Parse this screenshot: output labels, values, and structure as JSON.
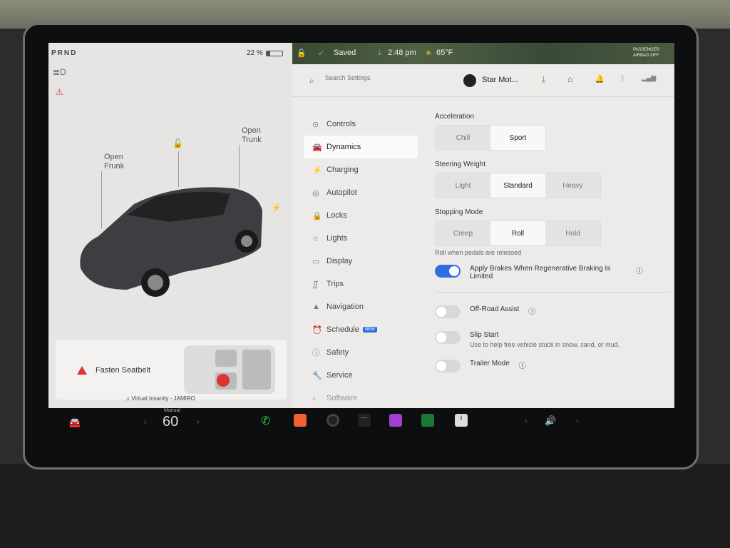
{
  "left": {
    "gear": "PRND",
    "battery": "22 %",
    "battery_fraction": 0.22,
    "open_frunk": "Open\nFrunk",
    "open_trunk": "Open\nTrunk",
    "alert": "Fasten Seatbelt",
    "music": "Virtual Insanity - JAMIRO"
  },
  "status": {
    "saved": "Saved",
    "time": "2:48 pm",
    "temp": "65°F",
    "airbag": "PASSENGER AIRBAG OFF"
  },
  "header": {
    "search_placeholder": "Search Settings",
    "profile": "Star Mot..."
  },
  "nav": [
    {
      "label": "Controls",
      "icon": "toggle-icon"
    },
    {
      "label": "Dynamics",
      "icon": "car-icon"
    },
    {
      "label": "Charging",
      "icon": "bolt-icon"
    },
    {
      "label": "Autopilot",
      "icon": "steering-icon"
    },
    {
      "label": "Locks",
      "icon": "lock-icon"
    },
    {
      "label": "Lights",
      "icon": "sun-icon"
    },
    {
      "label": "Display",
      "icon": "display-icon"
    },
    {
      "label": "Trips",
      "icon": "trips-icon"
    },
    {
      "label": "Navigation",
      "icon": "navigation-icon"
    },
    {
      "label": "Schedule",
      "icon": "clock-icon",
      "badge": "NEW"
    },
    {
      "label": "Safety",
      "icon": "safety-icon"
    },
    {
      "label": "Service",
      "icon": "wrench-icon"
    },
    {
      "label": "Software",
      "icon": "download-icon"
    }
  ],
  "active_nav": "Dynamics",
  "dynamics": {
    "acceleration": {
      "label": "Acceleration",
      "options": [
        "Chill",
        "Sport"
      ],
      "selected": "Sport"
    },
    "steering": {
      "label": "Steering Weight",
      "options": [
        "Light",
        "Standard",
        "Heavy"
      ],
      "selected": "Standard"
    },
    "stopping": {
      "label": "Stopping Mode",
      "options": [
        "Creep",
        "Roll",
        "Hold"
      ],
      "selected": "Roll",
      "hint": "Roll when pedals are released"
    },
    "regen": {
      "label": "Apply Brakes When Regenerative Braking Is Limited",
      "on": true
    },
    "offroad": {
      "label": "Off-Road Assist",
      "on": false
    },
    "slipstart": {
      "label": "Slip Start",
      "desc": "Use to help free vehicle stuck in snow, sand, or mud.",
      "on": false
    },
    "trailer": {
      "label": "Trailer Mode",
      "on": false
    }
  },
  "taskbar": {
    "temp_mode": "Manual",
    "temp": "60"
  },
  "colors": {
    "accent": "#2f6de0",
    "download": "#3aa34a"
  }
}
